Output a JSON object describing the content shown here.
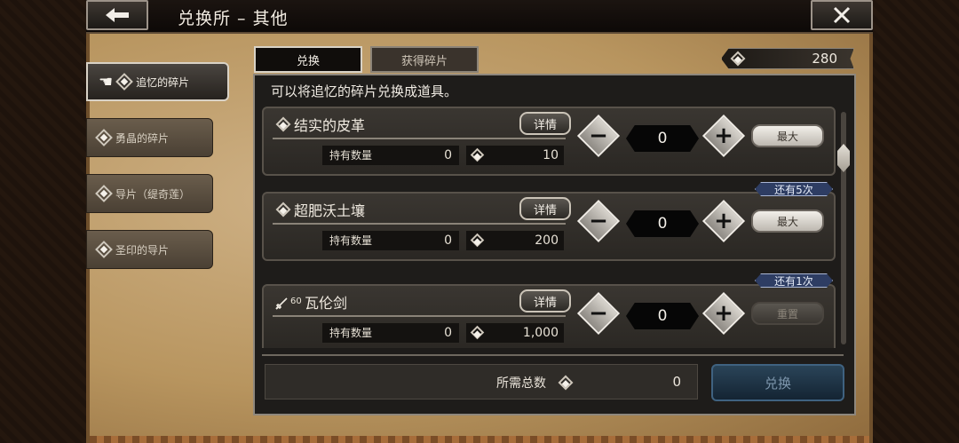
{
  "header": {
    "title": "兑换所 – 其他",
    "back_icon": "arrow-left-icon",
    "close_icon": "close-icon"
  },
  "sidebar": {
    "items": [
      {
        "label": "追忆的碎片",
        "active": true
      },
      {
        "label": "勇晶的碎片",
        "active": false
      },
      {
        "label": "导片（缇奇莲）",
        "active": false
      },
      {
        "label": "圣印的导片",
        "active": false
      }
    ]
  },
  "tabs": [
    {
      "label": "兑换",
      "active": true
    },
    {
      "label": "获得碎片",
      "active": false
    }
  ],
  "currency": {
    "value": "280"
  },
  "description": "可以将追忆的碎片兑换成道具。",
  "items": [
    {
      "name": "结实的皮革",
      "detail_label": "详情",
      "own_label": "持有数量",
      "own_value": "0",
      "cost": "10",
      "quantity": "0",
      "max_label": "最大",
      "max_enabled": true,
      "badge": ""
    },
    {
      "name": "超肥沃土壤",
      "detail_label": "详情",
      "own_label": "持有数量",
      "own_value": "0",
      "cost": "200",
      "quantity": "0",
      "max_label": "最大",
      "max_enabled": true,
      "badge": "还有5次"
    },
    {
      "name": "瓦伦剑",
      "level": "60",
      "detail_label": "详情",
      "own_label": "持有数量",
      "own_value": "0",
      "cost": "1,000",
      "quantity": "0",
      "max_label": "重置",
      "max_enabled": false,
      "badge": "还有1次"
    }
  ],
  "footer": {
    "total_label": "所需总数",
    "total_value": "0",
    "exchange_label": "兑换"
  },
  "colors": {
    "badge_bg": "#2e3d63",
    "exchange_btn": "#1c3346",
    "parchment": "#b8955f"
  }
}
